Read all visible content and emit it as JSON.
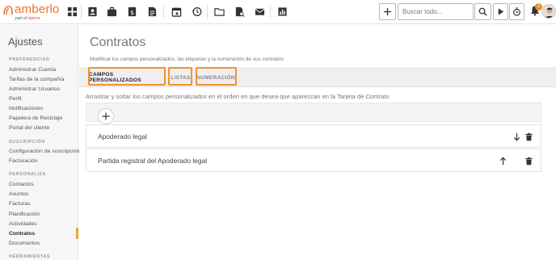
{
  "brand": {
    "name": "amberlo",
    "sub_prefix": "part of",
    "sub_brand": "stjerne",
    "accent": "#e8742c"
  },
  "topbar": {
    "nav_icons": [
      "dashboard-icon",
      "contacts-icon",
      "matters-icon",
      "billing-icon",
      "documents-icon",
      "calendar-icon",
      "timer-history-icon",
      "folder-icon",
      "reports-file-icon",
      "mail-icon",
      "analytics-icon"
    ],
    "search_placeholder": "Buscar todo...",
    "notification_count": "2"
  },
  "sidebar": {
    "title": "Ajustes",
    "sections": [
      {
        "heading": "PREFERENCIAS",
        "items": [
          "Administrar Cuenta",
          "Tarifas de la compañía",
          "Administrar Usuarios",
          "Perfil",
          "Notificaciones",
          "Papelera de Reciclaje",
          "Portal del cliente"
        ]
      },
      {
        "heading": "SUSCRIPCIÓN",
        "items": [
          "Configuración de suscripción",
          "Facturación"
        ]
      },
      {
        "heading": "PERSONALIZA",
        "items": [
          "Contactos",
          "Asuntos",
          "Facturas",
          "Planificación",
          "Actividades",
          "Contratos",
          "Documentos"
        ]
      },
      {
        "heading": "HERRAMIENTAS",
        "items": []
      }
    ],
    "active_item": "Contratos"
  },
  "main": {
    "title": "Contratos",
    "subtitle": "Modificar los campos personalizados, las etiquetas y la numeración de sus contratos",
    "tabs": [
      {
        "label": "CAMPOS PERSONALIZADOS",
        "active": true
      },
      {
        "label": "LISTAS",
        "active": false
      },
      {
        "label": "NUMERACIÓN",
        "active": false
      }
    ],
    "highlight_color": "#f0922e",
    "instruction": "Arrastrar y soltar los campos personalizados en el orden en que desea que aparezcan en la Tarjeta de Contrato",
    "fields": [
      {
        "name": "Apoderado legal",
        "move_icon": "arrow-down-icon"
      },
      {
        "name": "Partida registral del Apoderado legal",
        "move_icon": "arrow-up-icon"
      }
    ]
  }
}
